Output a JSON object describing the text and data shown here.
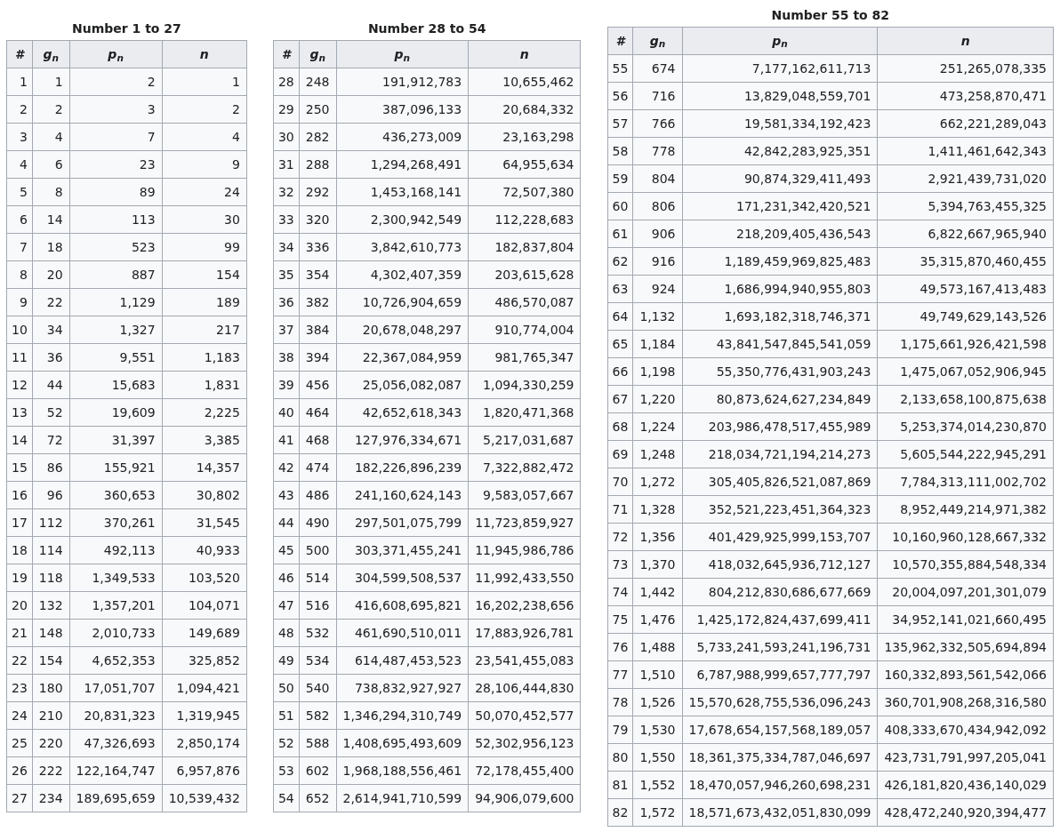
{
  "tables": [
    {
      "caption": "Number 1 to 27",
      "columns": [
        "#",
        "g$_{n}$",
        "p$_{n}$",
        "n"
      ],
      "rows": [
        [
          "1",
          "1",
          "2",
          "1"
        ],
        [
          "2",
          "2",
          "3",
          "2"
        ],
        [
          "3",
          "4",
          "7",
          "4"
        ],
        [
          "4",
          "6",
          "23",
          "9"
        ],
        [
          "5",
          "8",
          "89",
          "24"
        ],
        [
          "6",
          "14",
          "113",
          "30"
        ],
        [
          "7",
          "18",
          "523",
          "99"
        ],
        [
          "8",
          "20",
          "887",
          "154"
        ],
        [
          "9",
          "22",
          "1,129",
          "189"
        ],
        [
          "10",
          "34",
          "1,327",
          "217"
        ],
        [
          "11",
          "36",
          "9,551",
          "1,183"
        ],
        [
          "12",
          "44",
          "15,683",
          "1,831"
        ],
        [
          "13",
          "52",
          "19,609",
          "2,225"
        ],
        [
          "14",
          "72",
          "31,397",
          "3,385"
        ],
        [
          "15",
          "86",
          "155,921",
          "14,357"
        ],
        [
          "16",
          "96",
          "360,653",
          "30,802"
        ],
        [
          "17",
          "112",
          "370,261",
          "31,545"
        ],
        [
          "18",
          "114",
          "492,113",
          "40,933"
        ],
        [
          "19",
          "118",
          "1,349,533",
          "103,520"
        ],
        [
          "20",
          "132",
          "1,357,201",
          "104,071"
        ],
        [
          "21",
          "148",
          "2,010,733",
          "149,689"
        ],
        [
          "22",
          "154",
          "4,652,353",
          "325,852"
        ],
        [
          "23",
          "180",
          "17,051,707",
          "1,094,421"
        ],
        [
          "24",
          "210",
          "20,831,323",
          "1,319,945"
        ],
        [
          "25",
          "220",
          "47,326,693",
          "2,850,174"
        ],
        [
          "26",
          "222",
          "122,164,747",
          "6,957,876"
        ],
        [
          "27",
          "234",
          "189,695,659",
          "10,539,432"
        ]
      ]
    },
    {
      "caption": "Number 28 to 54",
      "columns": [
        "#",
        "g$_{n}$",
        "p$_{n}$",
        "n"
      ],
      "rows": [
        [
          "28",
          "248",
          "191,912,783",
          "10,655,462"
        ],
        [
          "29",
          "250",
          "387,096,133",
          "20,684,332"
        ],
        [
          "30",
          "282",
          "436,273,009",
          "23,163,298"
        ],
        [
          "31",
          "288",
          "1,294,268,491",
          "64,955,634"
        ],
        [
          "32",
          "292",
          "1,453,168,141",
          "72,507,380"
        ],
        [
          "33",
          "320",
          "2,300,942,549",
          "112,228,683"
        ],
        [
          "34",
          "336",
          "3,842,610,773",
          "182,837,804"
        ],
        [
          "35",
          "354",
          "4,302,407,359",
          "203,615,628"
        ],
        [
          "36",
          "382",
          "10,726,904,659",
          "486,570,087"
        ],
        [
          "37",
          "384",
          "20,678,048,297",
          "910,774,004"
        ],
        [
          "38",
          "394",
          "22,367,084,959",
          "981,765,347"
        ],
        [
          "39",
          "456",
          "25,056,082,087",
          "1,094,330,259"
        ],
        [
          "40",
          "464",
          "42,652,618,343",
          "1,820,471,368"
        ],
        [
          "41",
          "468",
          "127,976,334,671",
          "5,217,031,687"
        ],
        [
          "42",
          "474",
          "182,226,896,239",
          "7,322,882,472"
        ],
        [
          "43",
          "486",
          "241,160,624,143",
          "9,583,057,667"
        ],
        [
          "44",
          "490",
          "297,501,075,799",
          "11,723,859,927"
        ],
        [
          "45",
          "500",
          "303,371,455,241",
          "11,945,986,786"
        ],
        [
          "46",
          "514",
          "304,599,508,537",
          "11,992,433,550"
        ],
        [
          "47",
          "516",
          "416,608,695,821",
          "16,202,238,656"
        ],
        [
          "48",
          "532",
          "461,690,510,011",
          "17,883,926,781"
        ],
        [
          "49",
          "534",
          "614,487,453,523",
          "23,541,455,083"
        ],
        [
          "50",
          "540",
          "738,832,927,927",
          "28,106,444,830"
        ],
        [
          "51",
          "582",
          "1,346,294,310,749",
          "50,070,452,577"
        ],
        [
          "52",
          "588",
          "1,408,695,493,609",
          "52,302,956,123"
        ],
        [
          "53",
          "602",
          "1,968,188,556,461",
          "72,178,455,400"
        ],
        [
          "54",
          "652",
          "2,614,941,710,599",
          "94,906,079,600"
        ]
      ]
    },
    {
      "caption": "Number 55 to 82",
      "columns": [
        "#",
        "g$_{n}$",
        "p$_{n}$",
        "n"
      ],
      "rows": [
        [
          "55",
          "674",
          "7,177,162,611,713",
          "251,265,078,335"
        ],
        [
          "56",
          "716",
          "13,829,048,559,701",
          "473,258,870,471"
        ],
        [
          "57",
          "766",
          "19,581,334,192,423",
          "662,221,289,043"
        ],
        [
          "58",
          "778",
          "42,842,283,925,351",
          "1,411,461,642,343"
        ],
        [
          "59",
          "804",
          "90,874,329,411,493",
          "2,921,439,731,020"
        ],
        [
          "60",
          "806",
          "171,231,342,420,521",
          "5,394,763,455,325"
        ],
        [
          "61",
          "906",
          "218,209,405,436,543",
          "6,822,667,965,940"
        ],
        [
          "62",
          "916",
          "1,189,459,969,825,483",
          "35,315,870,460,455"
        ],
        [
          "63",
          "924",
          "1,686,994,940,955,803",
          "49,573,167,413,483"
        ],
        [
          "64",
          "1,132",
          "1,693,182,318,746,371",
          "49,749,629,143,526"
        ],
        [
          "65",
          "1,184",
          "43,841,547,845,541,059",
          "1,175,661,926,421,598"
        ],
        [
          "66",
          "1,198",
          "55,350,776,431,903,243",
          "1,475,067,052,906,945"
        ],
        [
          "67",
          "1,220",
          "80,873,624,627,234,849",
          "2,133,658,100,875,638"
        ],
        [
          "68",
          "1,224",
          "203,986,478,517,455,989",
          "5,253,374,014,230,870"
        ],
        [
          "69",
          "1,248",
          "218,034,721,194,214,273",
          "5,605,544,222,945,291"
        ],
        [
          "70",
          "1,272",
          "305,405,826,521,087,869",
          "7,784,313,111,002,702"
        ],
        [
          "71",
          "1,328",
          "352,521,223,451,364,323",
          "8,952,449,214,971,382"
        ],
        [
          "72",
          "1,356",
          "401,429,925,999,153,707",
          "10,160,960,128,667,332"
        ],
        [
          "73",
          "1,370",
          "418,032,645,936,712,127",
          "10,570,355,884,548,334"
        ],
        [
          "74",
          "1,442",
          "804,212,830,686,677,669",
          "20,004,097,201,301,079"
        ],
        [
          "75",
          "1,476",
          "1,425,172,824,437,699,411",
          "34,952,141,021,660,495"
        ],
        [
          "76",
          "1,488",
          "5,733,241,593,241,196,731",
          "135,962,332,505,694,894"
        ],
        [
          "77",
          "1,510",
          "6,787,988,999,657,777,797",
          "160,332,893,561,542,066"
        ],
        [
          "78",
          "1,526",
          "15,570,628,755,536,096,243",
          "360,701,908,268,316,580"
        ],
        [
          "79",
          "1,530",
          "17,678,654,157,568,189,057",
          "408,333,670,434,942,092"
        ],
        [
          "80",
          "1,550",
          "18,361,375,334,787,046,697",
          "423,731,791,997,205,041"
        ],
        [
          "81",
          "1,552",
          "18,470,057,946,260,698,231",
          "426,181,820,436,140,029"
        ],
        [
          "82",
          "1,572",
          "18,571,673,432,051,830,099",
          "428,472,240,920,394,477"
        ]
      ]
    }
  ]
}
